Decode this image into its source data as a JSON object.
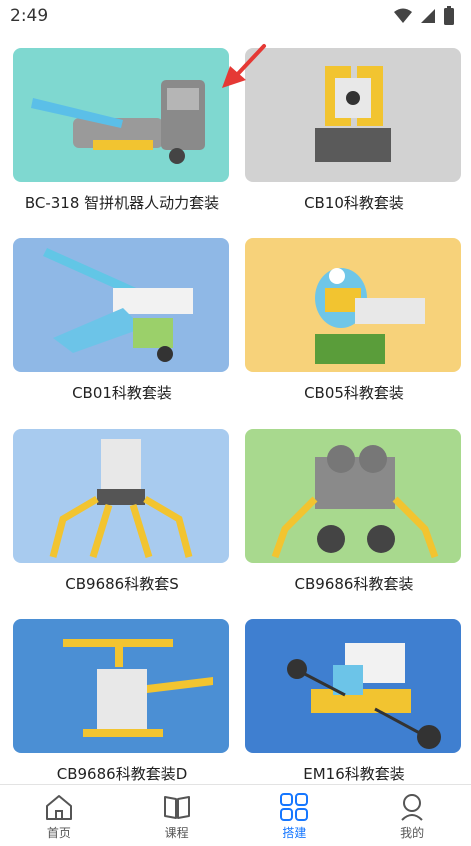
{
  "status_bar": {
    "time": "2:49"
  },
  "cards": [
    {
      "label": "BC-318 智拼机器人动力套装",
      "bg": "#7fd8d0"
    },
    {
      "label": "CB10科教套装",
      "bg": "#d2d2d2"
    },
    {
      "label": "CB01科教套装",
      "bg": "#8fb8e6"
    },
    {
      "label": "CB05科教套装",
      "bg": "#f7d27a"
    },
    {
      "label": "CB9686科教套S",
      "bg": "#a8cbef"
    },
    {
      "label": "CB9686科教套装",
      "bg": "#a8d98e"
    },
    {
      "label": "CB9686科教套装D",
      "bg": "#4b8fd4"
    },
    {
      "label": "EM16科教套装",
      "bg": "#3f7fd0"
    }
  ],
  "tabbar": {
    "tabs": [
      {
        "label": "首页",
        "icon": "home-icon"
      },
      {
        "label": "课程",
        "icon": "book-icon"
      },
      {
        "label": "搭建",
        "icon": "grid-icon"
      },
      {
        "label": "我的",
        "icon": "person-icon"
      }
    ],
    "active_color": "#1677ff"
  },
  "colors": {
    "accent": "#1677ff",
    "annotation_arrow": "#e53935"
  }
}
